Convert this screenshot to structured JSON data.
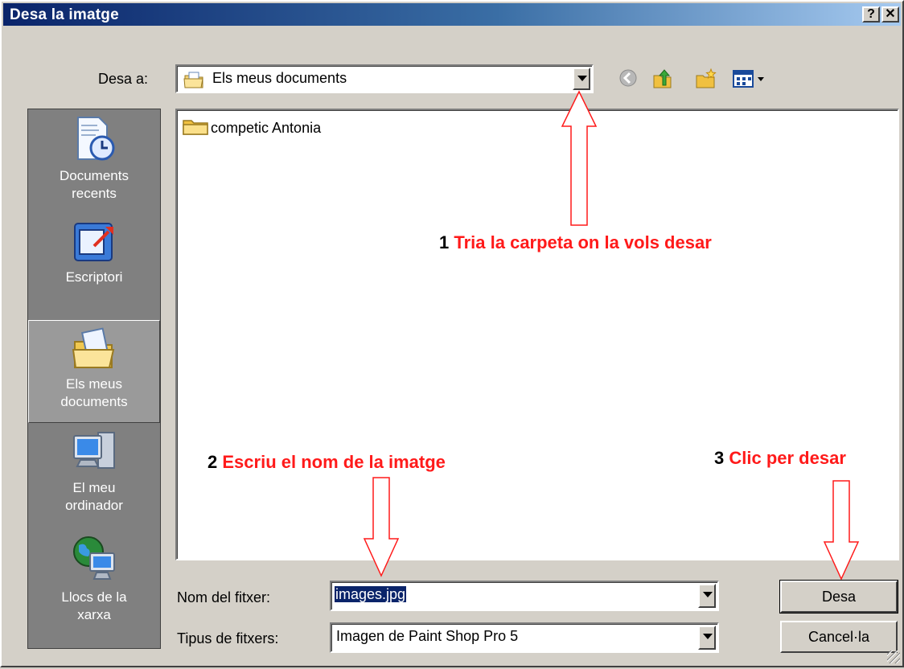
{
  "window": {
    "title": "Desa la imatge",
    "help_label": "?",
    "close_label": "✕"
  },
  "save_in": {
    "label": "Desa a:",
    "value": "Els meus documents"
  },
  "toolbar": {
    "icons": [
      "back-icon",
      "up-folder-icon",
      "new-folder-icon",
      "view-menu-icon"
    ]
  },
  "places": [
    {
      "line1": "Documents",
      "line2": "recents",
      "icon": "recent-documents-icon"
    },
    {
      "line1": "Escriptori",
      "line2": "",
      "icon": "desktop-icon"
    },
    {
      "line1": "Els meus",
      "line2": "documents",
      "icon": "my-documents-icon",
      "selected": true
    },
    {
      "line1": "El meu",
      "line2": "ordinador",
      "icon": "my-computer-icon"
    },
    {
      "line1": "Llocs de la",
      "line2": "xarxa",
      "icon": "network-places-icon"
    }
  ],
  "files": [
    {
      "name": "competic Antonia",
      "icon": "folder-icon"
    }
  ],
  "annotations": {
    "step1": {
      "num": "1",
      "text": "Tria la carpeta on la vols desar"
    },
    "step2": {
      "num": "2",
      "text": "Escriu el nom de la imatge"
    },
    "step3": {
      "num": "3",
      "text": "Clic per desar"
    },
    "color": "#ff1a1a"
  },
  "filename": {
    "label": "Nom del fitxer:",
    "value": "images.jpg"
  },
  "filetype": {
    "label": "Tipus de fitxers:",
    "value": "Imagen de Paint Shop Pro 5"
  },
  "buttons": {
    "save": "Desa",
    "cancel": "Cancel·la"
  }
}
